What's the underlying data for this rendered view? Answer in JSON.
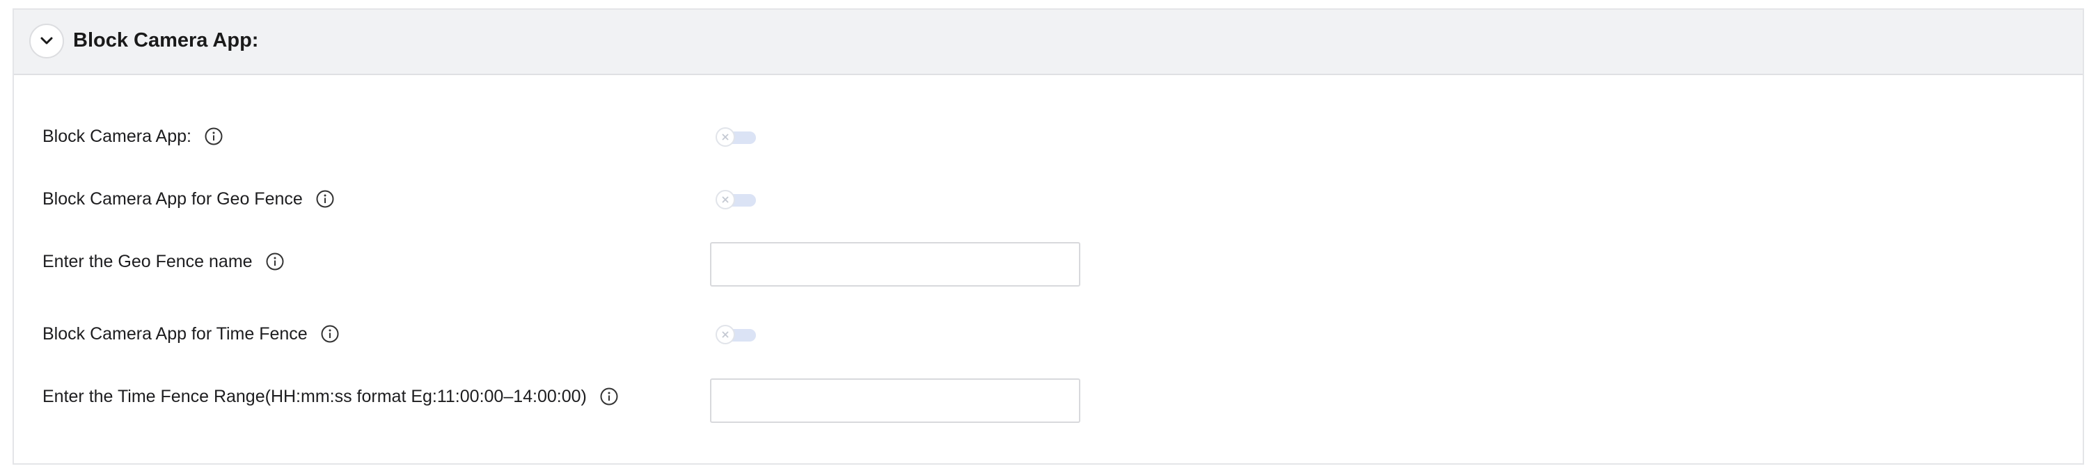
{
  "section": {
    "title": "Block Camera App:",
    "collapse_icon": "chevron-down-icon"
  },
  "rows": [
    {
      "label": "Block Camera App:",
      "type": "toggle",
      "enabled": false,
      "icon": "info-icon"
    },
    {
      "label": "Block Camera App for Geo Fence",
      "type": "toggle",
      "enabled": false,
      "icon": "info-icon"
    },
    {
      "label": "Enter the Geo Fence name",
      "type": "input",
      "value": "",
      "placeholder": "",
      "icon": "info-icon"
    },
    {
      "label": "Block Camera App for Time Fence",
      "type": "toggle",
      "enabled": false,
      "icon": "info-icon"
    },
    {
      "label": "Enter the Time Fence Range(HH:mm:ss format Eg:11:00:00–14:00:00)",
      "type": "input",
      "value": "",
      "placeholder": "",
      "icon": "info-icon"
    }
  ],
  "colors": {
    "header_bg": "#f1f2f4",
    "toggle_off_track": "#dbe3f5",
    "border": "#e4e5e8"
  }
}
